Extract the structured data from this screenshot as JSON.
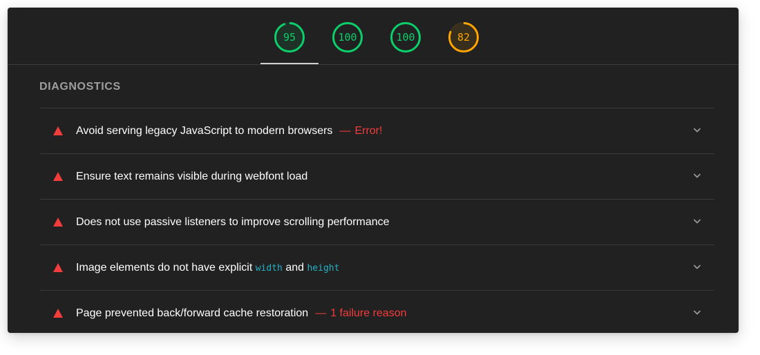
{
  "gauges": [
    {
      "score": "95",
      "value": 0.95,
      "color": "#0cce6b"
    },
    {
      "score": "100",
      "value": 1.0,
      "color": "#0cce6b"
    },
    {
      "score": "100",
      "value": 1.0,
      "color": "#0cce6b"
    },
    {
      "score": "82",
      "value": 0.82,
      "color": "#ffa400"
    }
  ],
  "diagnostics": {
    "title": "DIAGNOSTICS",
    "items": [
      {
        "text": "Avoid serving legacy JavaScript to modern browsers",
        "separator": "—",
        "extra": "Error!"
      },
      {
        "text": "Ensure text remains visible during webfont load"
      },
      {
        "text": "Does not use passive listeners to improve scrolling performance"
      },
      {
        "text_before": "Image elements do not have explicit",
        "code1": "width",
        "text_mid": "and",
        "code2": "height"
      },
      {
        "text": "Page prevented back/forward cache restoration",
        "separator": "—",
        "extra": "1 failure reason"
      }
    ]
  },
  "colors": {
    "fail": "#f33c3c",
    "pass": "#0cce6b",
    "average": "#ffa400",
    "code": "#23b3c7"
  },
  "icons": {
    "fail": "red-triangle-icon",
    "expand": "chevron-down-icon"
  }
}
